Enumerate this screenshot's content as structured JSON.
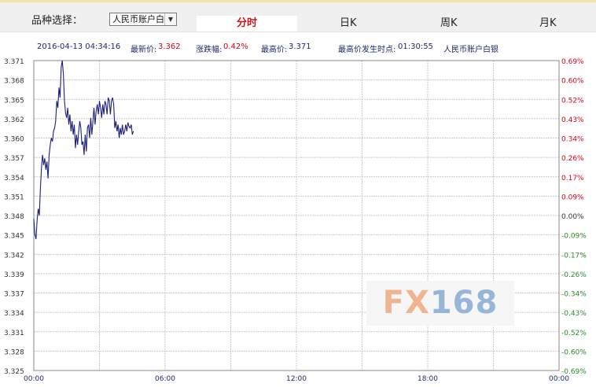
{
  "header": {
    "product_label": "品种选择：",
    "product_selected": "人民币账户白银",
    "tabs": [
      "分时",
      "日K",
      "周K",
      "月K"
    ],
    "active_tab": "分时"
  },
  "info": {
    "datetime": "2016-04-13 04:34:16",
    "latest_label": "最新价:",
    "latest_value": "3.362",
    "change_label": "涨跌幅:",
    "change_value": "0.42%",
    "high_label": "最高价:",
    "high_value": "3.371",
    "high_time_label": "最高价发生时点:",
    "high_time_value": "01:30:55",
    "product_name": "人民币账户白银"
  },
  "watermark": {
    "left": "FX",
    "right": "168"
  },
  "colors": {
    "line": "#1c1f7a",
    "up": "#d6001c",
    "down": "#2a8a2a",
    "grid": "#c9c9c9",
    "axis": "#888888"
  },
  "chart_data": {
    "type": "line",
    "title": "",
    "xlabel": "",
    "ylabel": "",
    "x_ticks": [
      "00:00",
      "06:00",
      "12:00",
      "18:00",
      "00:00"
    ],
    "x_range_hours": [
      0,
      24
    ],
    "ylim": [
      3.325,
      3.371
    ],
    "y_ticks": [
      "3.371",
      "3.368",
      "3.365",
      "3.362",
      "3.360",
      "3.357",
      "3.354",
      "3.351",
      "3.348",
      "3.345",
      "3.342",
      "3.339",
      "3.337",
      "3.334",
      "3.331",
      "3.328",
      "3.325"
    ],
    "y_right_ticks": [
      "0.69%",
      "0.60%",
      "0.52%",
      "0.43%",
      "0.34%",
      "0.26%",
      "0.17%",
      "0.09%",
      "0.00%",
      "-0.09%",
      "-0.17%",
      "-0.26%",
      "-0.34%",
      "-0.43%",
      "-0.52%",
      "-0.60%",
      "-0.69%"
    ],
    "grid": true,
    "series": [
      {
        "x": [
          0.0,
          0.05,
          0.1,
          0.15,
          0.2,
          0.25,
          0.3,
          0.35,
          0.4,
          0.45,
          0.5,
          0.55,
          0.6,
          0.65,
          0.7,
          0.75,
          0.8,
          0.85,
          0.9,
          0.95,
          1.0,
          1.05,
          1.1,
          1.15,
          1.2,
          1.25,
          1.3,
          1.35,
          1.4,
          1.45,
          1.5,
          1.55,
          1.6,
          1.65,
          1.7,
          1.75,
          1.8,
          1.85,
          1.9,
          1.95,
          2.0,
          2.05,
          2.1,
          2.15,
          2.2,
          2.25,
          2.3,
          2.35,
          2.4,
          2.45,
          2.5,
          2.55,
          2.6,
          2.65,
          2.7,
          2.75,
          2.8,
          2.85,
          2.9,
          2.95,
          3.0,
          3.05,
          3.1,
          3.15,
          3.2,
          3.25,
          3.3,
          3.35,
          3.4,
          3.45,
          3.5,
          3.55,
          3.6,
          3.65,
          3.7,
          3.75,
          3.8,
          3.85,
          3.9,
          3.95,
          4.0,
          4.05,
          4.1,
          4.15,
          4.2,
          4.25,
          4.3,
          4.35,
          4.4,
          4.45,
          4.5,
          4.55
        ],
        "values": [
          3.3475,
          3.3452,
          3.3445,
          3.3473,
          3.349,
          3.348,
          3.352,
          3.355,
          3.357,
          3.3555,
          3.3565,
          3.3548,
          3.356,
          3.3535,
          3.357,
          3.3585,
          3.3595,
          3.359,
          3.3605,
          3.361,
          3.362,
          3.365,
          3.364,
          3.367,
          3.3655,
          3.37,
          3.371,
          3.369,
          3.365,
          3.3632,
          3.3625,
          3.364,
          3.3615,
          3.363,
          3.3605,
          3.362,
          3.36,
          3.3615,
          3.358,
          3.36,
          3.3585,
          3.3605,
          3.362,
          3.361,
          3.3585,
          3.359,
          3.357,
          3.36,
          3.3575,
          3.361,
          3.3615,
          3.3595,
          3.3625,
          3.36,
          3.362,
          3.364,
          3.3615,
          3.3635,
          3.3645,
          3.363,
          3.365,
          3.364,
          3.3625,
          3.3645,
          3.363,
          3.365,
          3.3645,
          3.363,
          3.3655,
          3.365,
          3.363,
          3.365,
          3.3655,
          3.3645,
          3.361,
          3.362,
          3.3605,
          3.3615,
          3.3595,
          3.361,
          3.36,
          3.3615,
          3.36,
          3.3605,
          3.3615,
          3.3605,
          3.3618,
          3.3612,
          3.361,
          3.3615,
          3.36,
          3.3605
        ]
      }
    ]
  }
}
